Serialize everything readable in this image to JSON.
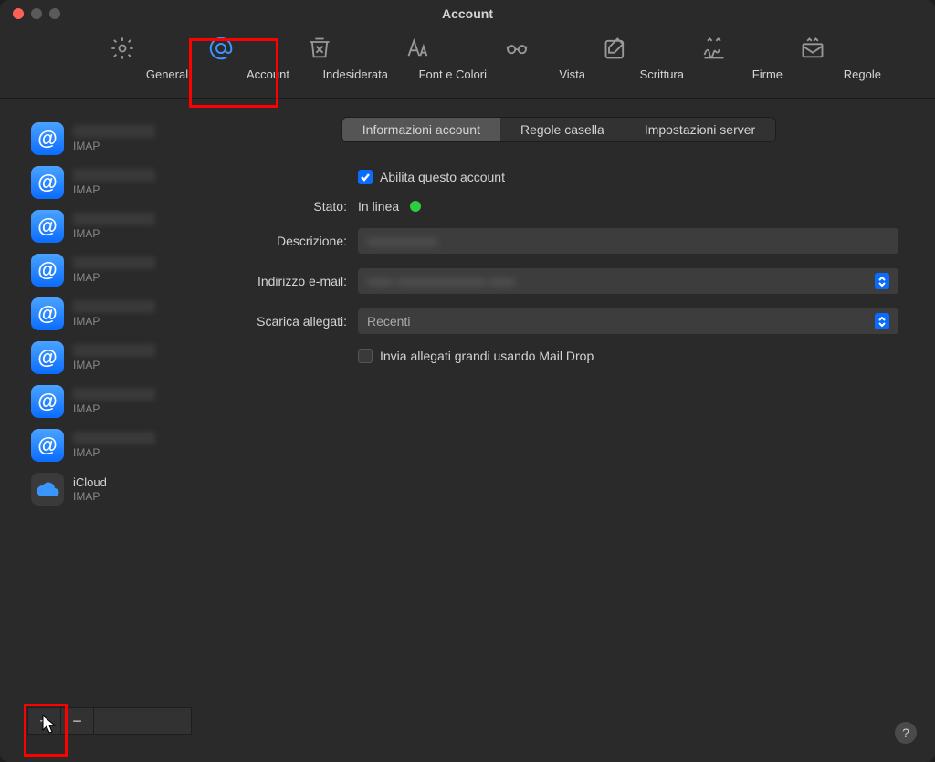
{
  "window_title": "Account",
  "toolbar": [
    {
      "id": "general",
      "label": "Generali"
    },
    {
      "id": "account",
      "label": "Account",
      "active": true
    },
    {
      "id": "junk",
      "label": "Indesiderata"
    },
    {
      "id": "fonts",
      "label": "Font e Colori"
    },
    {
      "id": "viewing",
      "label": "Vista"
    },
    {
      "id": "composing",
      "label": "Scrittura"
    },
    {
      "id": "signatures",
      "label": "Firme"
    },
    {
      "id": "rules",
      "label": "Regole"
    }
  ],
  "accounts": [
    {
      "name": "",
      "type": "IMAP",
      "icon": "at"
    },
    {
      "name": "",
      "type": "IMAP",
      "icon": "at"
    },
    {
      "name": "",
      "type": "IMAP",
      "icon": "at"
    },
    {
      "name": "",
      "type": "IMAP",
      "icon": "at"
    },
    {
      "name": "",
      "type": "IMAP",
      "icon": "at"
    },
    {
      "name": "",
      "type": "IMAP",
      "icon": "at"
    },
    {
      "name": "",
      "type": "IMAP",
      "icon": "at"
    },
    {
      "name": "",
      "type": "IMAP",
      "icon": "at"
    },
    {
      "name": "iCloud",
      "type": "IMAP",
      "icon": "cloud"
    }
  ],
  "tabs": [
    {
      "id": "info",
      "label": "Informazioni account",
      "active": true
    },
    {
      "id": "rules",
      "label": "Regole casella"
    },
    {
      "id": "server",
      "label": "Impostazioni server"
    }
  ],
  "form": {
    "enable_label": "Abilita questo account",
    "enable_checked": true,
    "status_label": "Stato:",
    "status_value": "In linea",
    "description_label": "Descrizione:",
    "description_value": "",
    "email_label": "Indirizzo e-mail:",
    "email_value": "",
    "download_label": "Scarica allegati:",
    "download_value": "Recenti",
    "maildrop_label": "Invia allegati grandi usando Mail Drop",
    "maildrop_checked": false
  },
  "footer": {
    "add": "+",
    "remove": "−"
  },
  "help": "?"
}
